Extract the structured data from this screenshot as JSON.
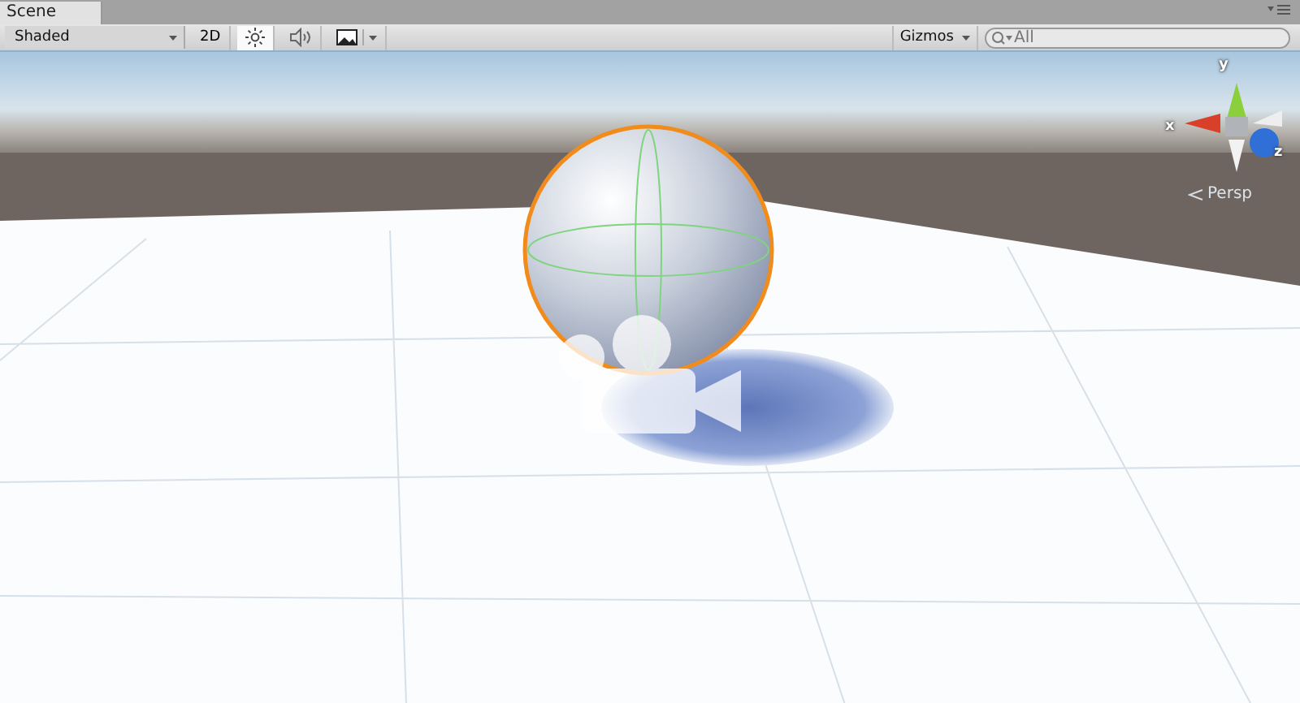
{
  "tabs": [
    {
      "label": "Scene",
      "selected": true
    }
  ],
  "toolbar": {
    "shading_mode": "Shaded",
    "toggles": [
      {
        "kind": "dimension",
        "label": "2D",
        "on": false
      },
      {
        "kind": "lighting",
        "on": true
      },
      {
        "kind": "audio",
        "on": false
      },
      {
        "kind": "effects",
        "on": false
      }
    ],
    "gizmos": "Gizmos",
    "search": {
      "placeholder": "All"
    }
  },
  "viewport": {
    "axis_labels": {
      "y": "y",
      "x": "x",
      "z": "z"
    },
    "projection": "Persp"
  }
}
